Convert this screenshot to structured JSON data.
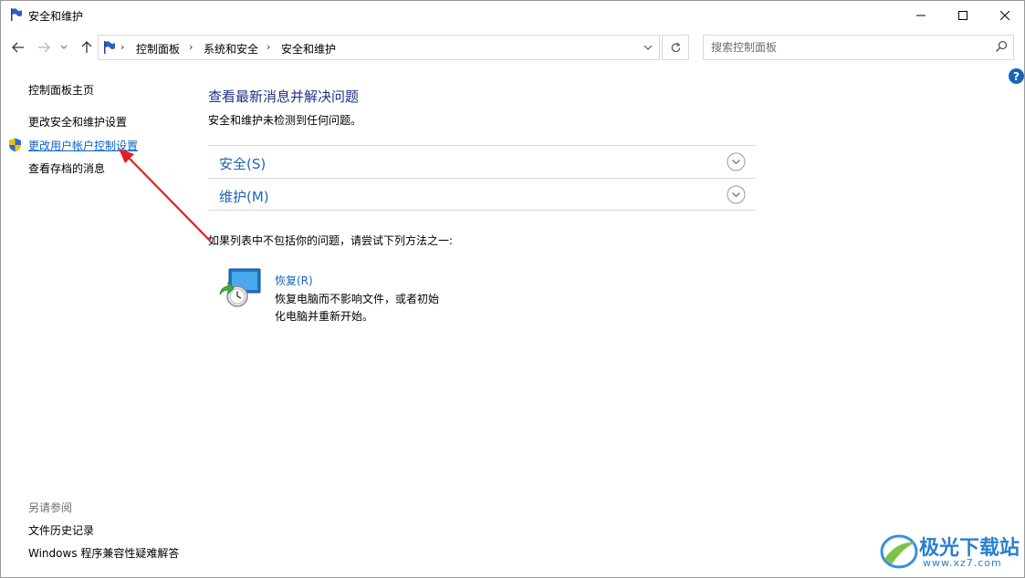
{
  "window": {
    "title": "安全和维护"
  },
  "address": {
    "crumbs": [
      "控制面板",
      "系统和安全",
      "安全和维护"
    ]
  },
  "search": {
    "placeholder": "搜索控制面板"
  },
  "help": {
    "label": "?"
  },
  "sidebar": {
    "items": [
      {
        "label": "控制面板主页"
      },
      {
        "label": "更改安全和维护设置"
      },
      {
        "label": "更改用户帐户控制设置"
      },
      {
        "label": "查看存档的消息"
      }
    ],
    "see_also_heading": "另请参阅",
    "see_also": [
      {
        "label": "文件历史记录"
      },
      {
        "label": "Windows 程序兼容性疑难解答"
      }
    ]
  },
  "main": {
    "title": "查看最新消息并解决问题",
    "subtitle": "安全和维护未检测到任何问题。",
    "sections": [
      {
        "label": "安全(S)"
      },
      {
        "label": "维护(M)"
      }
    ],
    "hint": "如果列表中不包括你的问题，请尝试下列方法之一:",
    "recovery": {
      "link": "恢复(R)",
      "description": "恢复电脑而不影响文件，或者初始化电脑并重新开始。"
    }
  },
  "watermark": {
    "text": "极光下载站",
    "url": "www.xz7.com"
  },
  "colors": {
    "link_blue": "#1e64b4",
    "title_navy": "#1e3287",
    "arrow_red": "#e02020"
  }
}
